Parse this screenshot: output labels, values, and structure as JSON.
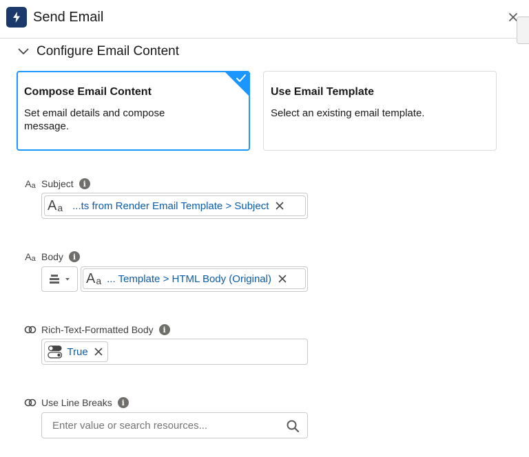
{
  "header": {
    "title": "Send Email"
  },
  "section": {
    "title": "Configure Email Content"
  },
  "options": [
    {
      "title": "Compose Email Content",
      "description": "Set email details and compose message.",
      "selected": true
    },
    {
      "title": "Use Email Template",
      "description": "Select an existing email template.",
      "selected": false
    }
  ],
  "fields": {
    "subject": {
      "label": "Subject",
      "pill": "...ts from Render Email Template > Subject"
    },
    "body": {
      "label": "Body",
      "pill": "... Template > HTML Body (Original)"
    },
    "rich_text": {
      "label": "Rich-Text-Formatted Body",
      "pill": "True"
    },
    "line_breaks": {
      "label": "Use Line Breaks",
      "placeholder": "Enter value or search resources..."
    }
  },
  "colors": {
    "accent": "#1b96ff",
    "pill_text": "#0b5cab",
    "app_icon_bg": "#1b3a6b"
  }
}
